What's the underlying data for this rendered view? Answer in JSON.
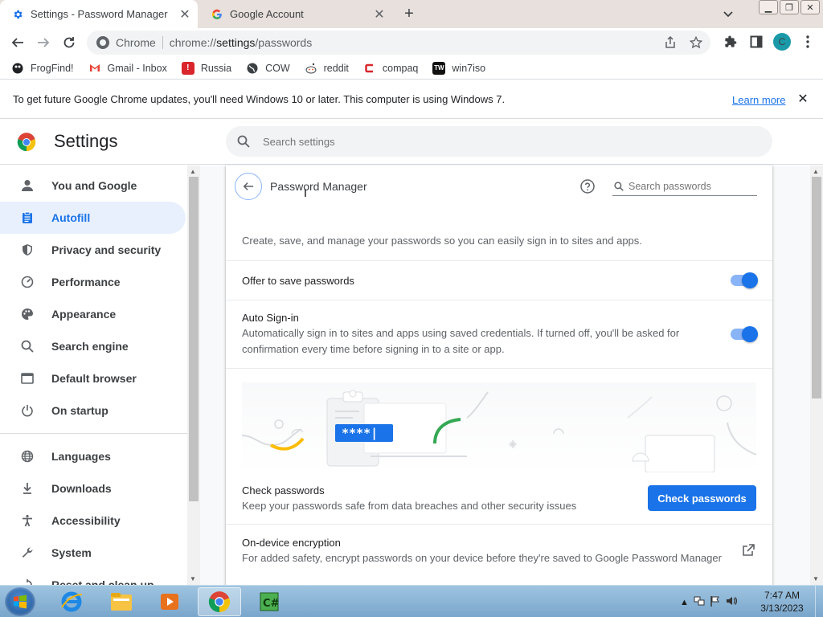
{
  "tabs": [
    {
      "title": "Settings - Password Manager",
      "icon": "gear-icon",
      "active": true
    },
    {
      "title": "Google Account",
      "icon": "google-icon",
      "active": false
    }
  ],
  "toolbar": {
    "site_chip": "Chrome",
    "url_scheme": "chrome://",
    "url_host": "settings",
    "url_path": "/passwords",
    "avatar_letter": "C"
  },
  "bookmarks": [
    {
      "label": "FrogFind!",
      "icon": "frogfind-icon"
    },
    {
      "label": "Gmail - Inbox",
      "icon": "gmail-icon"
    },
    {
      "label": "Russia",
      "icon": "russia-icon"
    },
    {
      "label": "COW",
      "icon": "globe-icon"
    },
    {
      "label": "reddit",
      "icon": "reddit-icon"
    },
    {
      "label": "compaq",
      "icon": "compaq-icon"
    },
    {
      "label": "win7iso",
      "icon": "win7iso-icon"
    }
  ],
  "infobar": {
    "message": "To get future Google Chrome updates, you'll need Windows 10 or later. This computer is using Windows 7.",
    "learn_more": "Learn more"
  },
  "settings": {
    "title": "Settings",
    "search_placeholder": "Search settings"
  },
  "sidebar": {
    "items": [
      {
        "label": "You and Google",
        "icon": "person-icon"
      },
      {
        "label": "Autofill",
        "icon": "autofill-icon",
        "active": true
      },
      {
        "label": "Privacy and security",
        "icon": "shield-icon"
      },
      {
        "label": "Performance",
        "icon": "speedometer-icon"
      },
      {
        "label": "Appearance",
        "icon": "palette-icon"
      },
      {
        "label": "Search engine",
        "icon": "search-icon"
      },
      {
        "label": "Default browser",
        "icon": "browser-icon"
      },
      {
        "label": "On startup",
        "icon": "power-icon"
      }
    ],
    "items2": [
      {
        "label": "Languages",
        "icon": "globe-icon"
      },
      {
        "label": "Downloads",
        "icon": "download-icon"
      },
      {
        "label": "Accessibility",
        "icon": "accessibility-icon"
      },
      {
        "label": "System",
        "icon": "wrench-icon"
      },
      {
        "label": "Reset and clean up",
        "icon": "reset-icon"
      }
    ]
  },
  "password_manager": {
    "title": "Password Manager",
    "search_placeholder": "Search passwords",
    "description": "Create, save, and manage your passwords so you can easily sign in to sites and apps.",
    "offer_to_save": {
      "label": "Offer to save passwords",
      "enabled": true
    },
    "auto_signin": {
      "label": "Auto Sign-in",
      "description_line1": "Automatically sign in to sites and apps using saved credentials. If turned off, you'll be asked for",
      "description_line2": "confirmation every time before signing in to a site or app.",
      "enabled": true
    },
    "illustration_text": "****|",
    "check_passwords": {
      "label": "Check passwords",
      "description": "Keep your passwords safe from data breaches and other security issues",
      "button": "Check passwords"
    },
    "encryption": {
      "label": "On-device encryption",
      "description": "For added safety, encrypt passwords on your device before they're saved to Google Password Manager"
    }
  },
  "taskbar": {
    "clock_time": "7:47 AM",
    "clock_date": "3/13/2023",
    "apps": [
      "ie-icon",
      "explorer-icon",
      "media-player-icon",
      "chrome-icon",
      "csharp-icon"
    ]
  },
  "colors": {
    "accent": "#1a73e8",
    "accent_light": "#e8f0fe",
    "tabstrip": "#e8e0dc"
  }
}
